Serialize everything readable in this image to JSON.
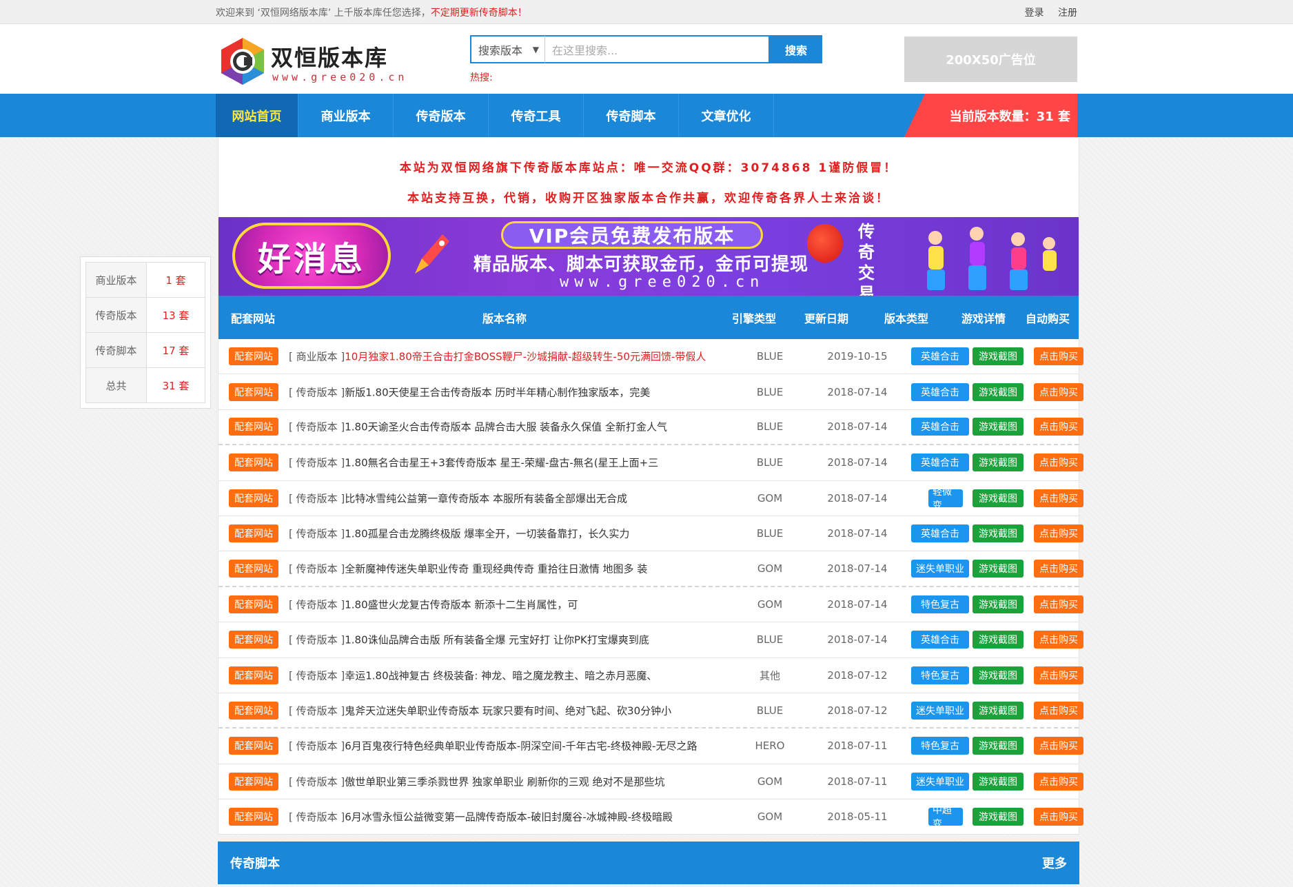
{
  "topbar": {
    "welcome": "欢迎来到 ‘双恒网络版本库’ 上千版本库任您选择，",
    "welcome_red": "不定期更新传奇脚本！",
    "login": "登录",
    "register": "注册"
  },
  "logo": {
    "title": "双恒版本库",
    "url": "www.gree020.cn"
  },
  "search": {
    "select_value": "搜索版本",
    "placeholder": "在这里搜索...",
    "button": "搜索",
    "hot_label": "热搜:"
  },
  "ad": {
    "label": "200X50广告位"
  },
  "nav": {
    "items": [
      "网站首页",
      "商业版本",
      "传奇版本",
      "传奇工具",
      "传奇脚本",
      "文章优化"
    ],
    "count": "当前版本数量：31 套"
  },
  "sidebar": {
    "rows": [
      {
        "label": "商业版本",
        "value": "1 套"
      },
      {
        "label": "传奇版本",
        "value": "13 套"
      },
      {
        "label": "传奇脚本",
        "value": "17 套"
      },
      {
        "label": "总共",
        "value": "31 套"
      }
    ]
  },
  "notice": {
    "line1": "本站为双恒网络旗下传奇版本库站点：唯一交流QQ群：3074868 1谨防假冒！",
    "line2": "本站支持互换，代销，收购开区独家版本合作共赢，欢迎传奇各界人士来洽谈！"
  },
  "banner": {
    "badge": "好消息",
    "headline": "VIP会员免费发布版本",
    "subline": "精品版本、脚本可获取金币，金币可提现",
    "url": "www.gree020.cn",
    "market": "传奇交易市场"
  },
  "table": {
    "headers": {
      "site": "配套网站",
      "name": "版本名称",
      "engine": "引擎类型",
      "date": "更新日期",
      "type": "版本类型",
      "detail": "游戏详情",
      "buy": "自动购买"
    },
    "rows": [
      {
        "site": "配套网站",
        "cat": "[ 商业版本 ]",
        "name": "10月独家1.80帝王合击打金BOSS鞭尸-沙城捐献-超级转生-50元满回馈-带假人",
        "red": true,
        "engine": "BLUE",
        "date": "2019-10-15",
        "type": "英雄合击",
        "shot": "游戏截图",
        "buy": "点击购买"
      },
      {
        "site": "配套网站",
        "cat": "[ 传奇版本 ]",
        "name": "新版1.80天使星王合击传奇版本 历时半年精心制作独家版本，完美",
        "engine": "BLUE",
        "date": "2018-07-14",
        "type": "英雄合击",
        "shot": "游戏截图",
        "buy": "点击购买"
      },
      {
        "site": "配套网站",
        "cat": "[ 传奇版本 ]",
        "name": "1.80天谕圣火合击传奇版本 品牌合击大服 装备永久保值 全新打金人气",
        "engine": "BLUE",
        "date": "2018-07-14",
        "type": "英雄合击",
        "shot": "游戏截图",
        "buy": "点击购买"
      },
      {
        "site": "配套网站",
        "cat": "[ 传奇版本 ]",
        "name": "1.80無名合击星王+3套传奇版本 星王-荣耀-盘古-無名(星王上面+三",
        "engine": "BLUE",
        "date": "2018-07-14",
        "type": "英雄合击",
        "shot": "游戏截图",
        "buy": "点击购买"
      },
      {
        "site": "配套网站",
        "cat": "[ 传奇版本 ]",
        "name": "比特冰雪纯公益第一章传奇版本 本服所有装备全部爆出无合成",
        "engine": "GOM",
        "date": "2018-07-14",
        "type": "轻微变",
        "shot": "游戏截图",
        "buy": "点击购买"
      },
      {
        "site": "配套网站",
        "cat": "[ 传奇版本 ]",
        "name": "1.80孤星合击龙腾终极版 爆率全开，一切装备靠打，长久实力",
        "engine": "BLUE",
        "date": "2018-07-14",
        "type": "英雄合击",
        "shot": "游戏截图",
        "buy": "点击购买"
      },
      {
        "site": "配套网站",
        "cat": "[ 传奇版本 ]",
        "name": "全新魔神传迷失单职业传奇 重现经典传奇 重拾往日激情 地图多 装",
        "engine": "GOM",
        "date": "2018-07-14",
        "type": "迷失单职业",
        "shot": "游戏截图",
        "buy": "点击购买"
      },
      {
        "site": "配套网站",
        "cat": "[ 传奇版本 ]",
        "name": "1.80盛世火龙复古传奇版本 新添十二生肖属性，可",
        "engine": "GOM",
        "date": "2018-07-14",
        "type": "特色复古",
        "shot": "游戏截图",
        "buy": "点击购买"
      },
      {
        "site": "配套网站",
        "cat": "[ 传奇版本 ]",
        "name": "1.80诛仙品牌合击版 所有装备全爆 元宝好打 让你PK打宝爆爽到底",
        "engine": "BLUE",
        "date": "2018-07-14",
        "type": "英雄合击",
        "shot": "游戏截图",
        "buy": "点击购买"
      },
      {
        "site": "配套网站",
        "cat": "[ 传奇版本 ]",
        "name": "幸运1.80战神复古 终极装备: 神龙、暗之魔龙教主、暗之赤月恶魔、",
        "engine": "其他",
        "date": "2018-07-12",
        "type": "特色复古",
        "shot": "游戏截图",
        "buy": "点击购买"
      },
      {
        "site": "配套网站",
        "cat": "[ 传奇版本 ]",
        "name": "鬼斧天泣迷失单职业传奇版本 玩家只要有时间、绝对飞起、砍30分钟小",
        "engine": "BLUE",
        "date": "2018-07-12",
        "type": "迷失单职业",
        "shot": "游戏截图",
        "buy": "点击购买"
      },
      {
        "site": "配套网站",
        "cat": "[ 传奇版本 ]",
        "name": "6月百鬼夜行特色经典单职业传奇版本-阴深空间-千年古宅-终极神殿-无尽之路",
        "engine": "HERO",
        "date": "2018-07-11",
        "type": "特色复古",
        "shot": "游戏截图",
        "buy": "点击购买"
      },
      {
        "site": "配套网站",
        "cat": "[ 传奇版本 ]",
        "name": "傲世单职业第三季杀戮世界 独家单职业 刷新你的三观 绝对不是那些坑",
        "engine": "GOM",
        "date": "2018-07-11",
        "type": "迷失单职业",
        "shot": "游戏截图",
        "buy": "点击购买"
      },
      {
        "site": "配套网站",
        "cat": "[ 传奇版本 ]",
        "name": "6月冰雪永恒公益微变第一品牌传奇版本-破旧封魔谷-冰城神殿-终极暗殿",
        "engine": "GOM",
        "date": "2018-05-11",
        "type": "中超变",
        "shot": "游戏截图",
        "buy": "点击购买"
      }
    ]
  },
  "section": {
    "title": "传奇脚本",
    "more": "更多"
  },
  "colors": {
    "primary": "#1a87d9",
    "red": "#e02020",
    "orange": "#ff6d12",
    "green": "#1ca23a",
    "count_bg": "#ff4545"
  }
}
